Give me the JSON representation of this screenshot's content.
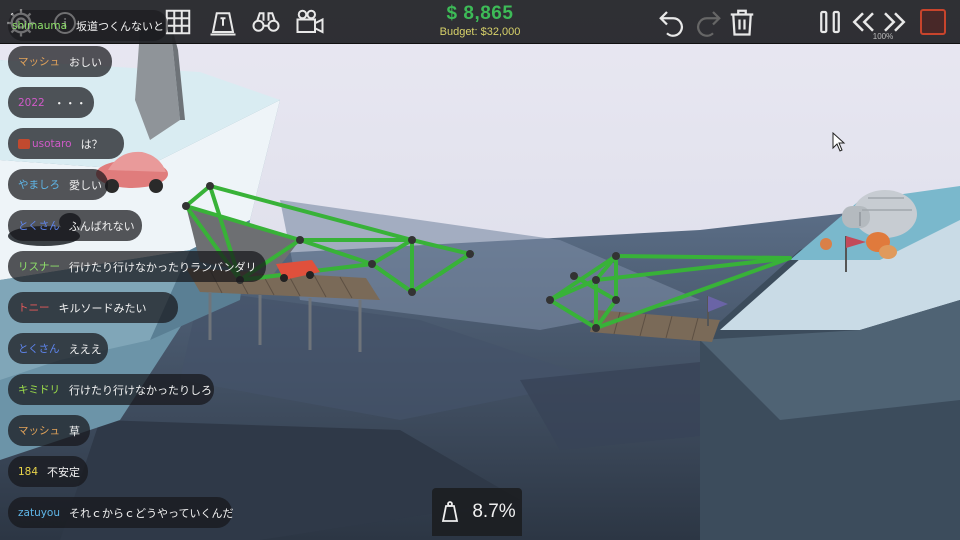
{
  "toolbar": {
    "money": "$ 8,865",
    "budget": "Budget: $32,000",
    "speed": "100%",
    "icons": [
      "gear-icon",
      "info-icon",
      "grid-icon",
      "weight-icon",
      "binoculars-icon",
      "camera-icon",
      "undo-icon",
      "redo-icon",
      "trash-icon",
      "pause-icon",
      "rewind-icon",
      "fast-forward-icon",
      "stop-icon"
    ]
  },
  "stress": {
    "value": "8.7%",
    "icon": "weight-icon"
  },
  "chat": [
    {
      "user": "shimauma",
      "user_color": "#8ee06a",
      "text": "坂道つくんないと"
    },
    {
      "user": "マッシュ",
      "user_color": "#e3a45a",
      "text": "おしい"
    },
    {
      "user": "2022",
      "user_color": "#d05ac8",
      "text": "・・・"
    },
    {
      "user": "usotaro",
      "user_color": "#d05ac8",
      "text": "は？",
      "badge": true
    },
    {
      "user": "やましろ",
      "user_color": "#5fb6e8",
      "text": "愛しい"
    },
    {
      "user": "とくさん",
      "user_color": "#5f86f0",
      "text": "ふんばれない"
    },
    {
      "user": "リスナー",
      "user_color": "#8ee06a",
      "text": "行けたり行けなかったりランバンダリ"
    },
    {
      "user": "トニー",
      "user_color": "#e85a5a",
      "text": "キルソードみたい"
    },
    {
      "user": "とくさん",
      "user_color": "#5f86f0",
      "text": "えええ"
    },
    {
      "user": "キミドリ",
      "user_color": "#9ee04a",
      "text": "行けたり行けなかったりしろ"
    },
    {
      "user": "マッシュ",
      "user_color": "#e3a45a",
      "text": "草"
    },
    {
      "user": "184",
      "user_color": "#e8d44a",
      "text": "不安定"
    },
    {
      "user": "zatuyou",
      "user_color": "#5fb6e8",
      "text": "それｃからｃどうやっていくんだ"
    }
  ]
}
